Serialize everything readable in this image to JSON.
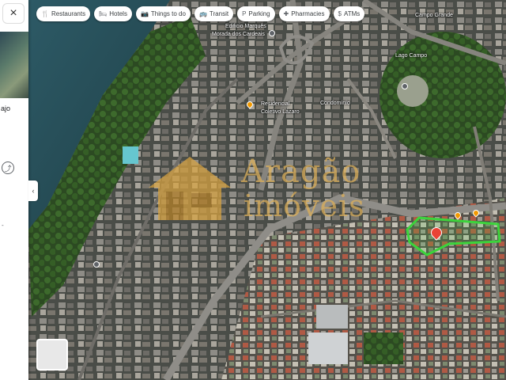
{
  "side_panel": {
    "close_icon": "×",
    "place_text": "ajo",
    "share_icon": "share-icon",
    "dash_text": "-"
  },
  "chips": [
    {
      "icon": "restaurant-icon",
      "glyph": "🍴",
      "label": "Restaurants"
    },
    {
      "icon": "hotel-icon",
      "glyph": "🛏",
      "label": "Hotels"
    },
    {
      "icon": "things-to-do-icon",
      "glyph": "📷",
      "label": "Things to do"
    },
    {
      "icon": "transit-icon",
      "glyph": "🚌",
      "label": "Transit"
    },
    {
      "icon": "parking-icon",
      "glyph": "P",
      "label": "Parking"
    },
    {
      "icon": "pharmacy-icon",
      "glyph": "✚",
      "label": "Pharmacies"
    },
    {
      "icon": "atm-icon",
      "glyph": "$",
      "label": "ATMs"
    }
  ],
  "map_labels": {
    "building_1": "Edificio Marquês",
    "building_2": "Morada dos Cardeais",
    "square_name": "Lago Campo",
    "campo_grande": "Campo Grande",
    "poi_1": "Condomínio",
    "poi_2": "Residencial",
    "poi_3": "Coletivo Lázaro"
  },
  "watermark": {
    "line1": "Aragão",
    "line2": "imóveis"
  },
  "colors": {
    "highlight_polygon": "#3bd43b",
    "pin_selected": "#ea4335",
    "watermark": "#e0b25a"
  }
}
